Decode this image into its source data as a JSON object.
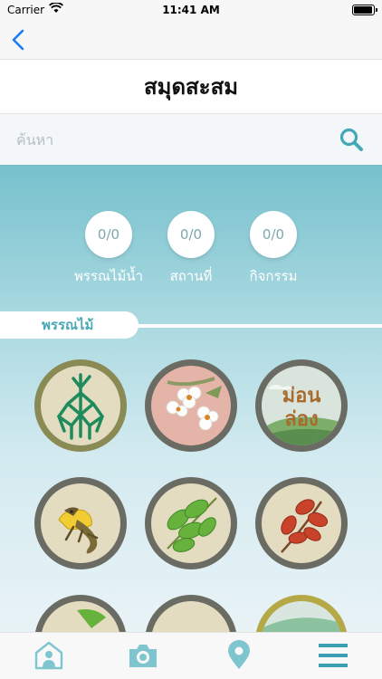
{
  "status_bar": {
    "carrier": "Carrier",
    "time": "11:41 AM"
  },
  "header": {
    "title": "สมุดสะสม"
  },
  "search": {
    "placeholder": "ค้นหา"
  },
  "stats": [
    {
      "value": "0/0",
      "label": "พรรณไม้น้ำ"
    },
    {
      "value": "0/0",
      "label": "สถานที่"
    },
    {
      "value": "0/0",
      "label": "กิจกรรม"
    }
  ],
  "section": {
    "label": "พรรณไม้"
  },
  "badges": [
    {
      "name": "mangrove-roots-badge",
      "frame_color": "#8a8a55"
    },
    {
      "name": "white-orchid-badge",
      "frame_color": "#6a6b63"
    },
    {
      "name": "mae-hong-son-logo-badge",
      "frame_color": "#6a6b63",
      "text": "ม่อนล่อง"
    },
    {
      "name": "frilled-lizard-badge",
      "frame_color": "#6a6b63"
    },
    {
      "name": "green-leaves-badge",
      "frame_color": "#6a6b63"
    },
    {
      "name": "red-leaves-badge",
      "frame_color": "#6a6b63"
    }
  ],
  "colors": {
    "accent": "#4ba8b5",
    "nav_blue": "#1a7cf5",
    "tab_icon": "#7fc5cf"
  },
  "tabbar": {
    "icons": [
      "home-icon",
      "camera-icon",
      "map-pin-icon",
      "menu-icon"
    ]
  }
}
